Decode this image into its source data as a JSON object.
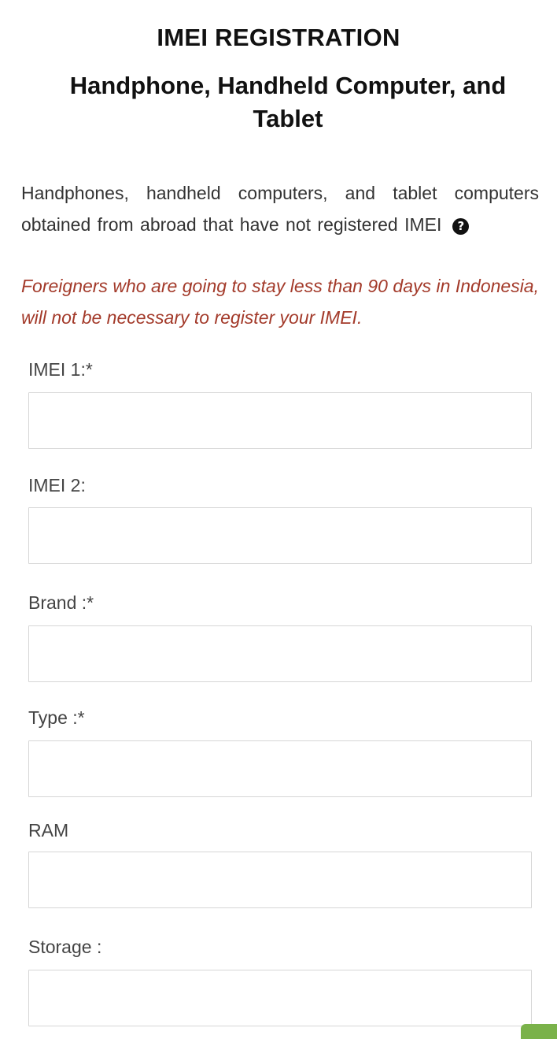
{
  "header": {
    "title": "IMEI REGISTRATION",
    "subtitle": "Handphone, Handheld Computer, and Tablet"
  },
  "intro": {
    "text": "Handphones, handheld computers, and tablet computers obtained from abroad that have not registered IMEI",
    "help_icon": "question-circle-icon",
    "help_glyph": "?"
  },
  "notice": {
    "text": "Foreigners who are going to stay less than 90 days in Indonesia, will not be necessary to register your IMEI.",
    "color": "#a33a2a"
  },
  "form": {
    "imei1": {
      "label": "IMEI 1:*",
      "value": ""
    },
    "imei2": {
      "label": "IMEI 2:",
      "value": ""
    },
    "brand": {
      "label": "Brand :*",
      "value": ""
    },
    "type": {
      "label": "Type :*",
      "value": ""
    },
    "ram": {
      "label": "RAM",
      "value": ""
    },
    "storage": {
      "label": "Storage :",
      "value": ""
    }
  },
  "colors": {
    "accent_green": "#7ab24a"
  }
}
